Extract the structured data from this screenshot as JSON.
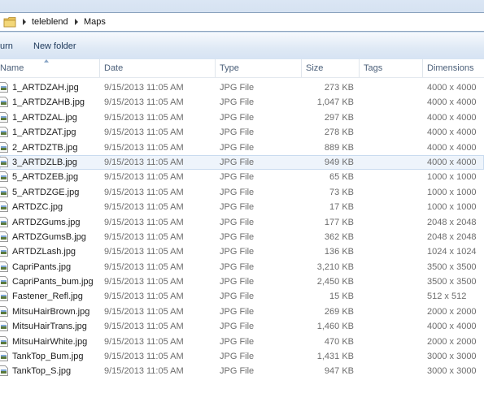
{
  "address": {
    "crumbs": [
      "teleblend",
      "Maps"
    ]
  },
  "toolbar": {
    "back_label": "urn",
    "new_folder_label": "New folder"
  },
  "columns": {
    "name": "Name",
    "date": "Date",
    "type": "Type",
    "size": "Size",
    "tags": "Tags",
    "dimensions": "Dimensions"
  },
  "files": [
    {
      "name": "1_ARTDZAH.jpg",
      "date": "9/15/2013 11:05 AM",
      "type": "JPG File",
      "size": "273 KB",
      "dim": "4000 x 4000"
    },
    {
      "name": "1_ARTDZAHB.jpg",
      "date": "9/15/2013 11:05 AM",
      "type": "JPG File",
      "size": "1,047 KB",
      "dim": "4000 x 4000"
    },
    {
      "name": "1_ARTDZAL.jpg",
      "date": "9/15/2013 11:05 AM",
      "type": "JPG File",
      "size": "297 KB",
      "dim": "4000 x 4000"
    },
    {
      "name": "1_ARTDZAT.jpg",
      "date": "9/15/2013 11:05 AM",
      "type": "JPG File",
      "size": "278 KB",
      "dim": "4000 x 4000"
    },
    {
      "name": "2_ARTDZTB.jpg",
      "date": "9/15/2013 11:05 AM",
      "type": "JPG File",
      "size": "889 KB",
      "dim": "4000 x 4000"
    },
    {
      "name": "3_ARTDZLB.jpg",
      "date": "9/15/2013 11:05 AM",
      "type": "JPG File",
      "size": "949 KB",
      "dim": "4000 x 4000"
    },
    {
      "name": "5_ARTDZEB.jpg",
      "date": "9/15/2013 11:05 AM",
      "type": "JPG File",
      "size": "65 KB",
      "dim": "1000 x 1000"
    },
    {
      "name": "5_ARTDZGE.jpg",
      "date": "9/15/2013 11:05 AM",
      "type": "JPG File",
      "size": "73 KB",
      "dim": "1000 x 1000"
    },
    {
      "name": "ARTDZC.jpg",
      "date": "9/15/2013 11:05 AM",
      "type": "JPG File",
      "size": "17 KB",
      "dim": "1000 x 1000"
    },
    {
      "name": "ARTDZGums.jpg",
      "date": "9/15/2013 11:05 AM",
      "type": "JPG File",
      "size": "177 KB",
      "dim": "2048 x 2048"
    },
    {
      "name": "ARTDZGumsB.jpg",
      "date": "9/15/2013 11:05 AM",
      "type": "JPG File",
      "size": "362 KB",
      "dim": "2048 x 2048"
    },
    {
      "name": "ARTDZLash.jpg",
      "date": "9/15/2013 11:05 AM",
      "type": "JPG File",
      "size": "136 KB",
      "dim": "1024 x 1024"
    },
    {
      "name": "CapriPants.jpg",
      "date": "9/15/2013 11:05 AM",
      "type": "JPG File",
      "size": "3,210 KB",
      "dim": "3500 x 3500"
    },
    {
      "name": "CapriPants_bum.jpg",
      "date": "9/15/2013 11:05 AM",
      "type": "JPG File",
      "size": "2,450 KB",
      "dim": "3500 x 3500"
    },
    {
      "name": "Fastener_Refl.jpg",
      "date": "9/15/2013 11:05 AM",
      "type": "JPG File",
      "size": "15 KB",
      "dim": "512 x 512"
    },
    {
      "name": "MitsuHairBrown.jpg",
      "date": "9/15/2013 11:05 AM",
      "type": "JPG File",
      "size": "269 KB",
      "dim": "2000 x 2000"
    },
    {
      "name": "MitsuHairTrans.jpg",
      "date": "9/15/2013 11:05 AM",
      "type": "JPG File",
      "size": "1,460 KB",
      "dim": "4000 x 4000"
    },
    {
      "name": "MitsuHairWhite.jpg",
      "date": "9/15/2013 11:05 AM",
      "type": "JPG File",
      "size": "470 KB",
      "dim": "2000 x 2000"
    },
    {
      "name": "TankTop_Bum.jpg",
      "date": "9/15/2013 11:05 AM",
      "type": "JPG File",
      "size": "1,431 KB",
      "dim": "3000 x 3000"
    },
    {
      "name": "TankTop_S.jpg",
      "date": "9/15/2013 11:05 AM",
      "type": "JPG File",
      "size": "947 KB",
      "dim": "3000 x 3000"
    }
  ],
  "selected_index": 5,
  "icons": {
    "folder": "folder-icon",
    "file": "jpg-file-icon",
    "breadcrumb_separator": "chevron-right-icon"
  },
  "colors": {
    "toolbar_text": "#1e395b",
    "header_text": "#4c607a",
    "detail_text": "#6d6d6d",
    "selection": "#eef4fb"
  }
}
